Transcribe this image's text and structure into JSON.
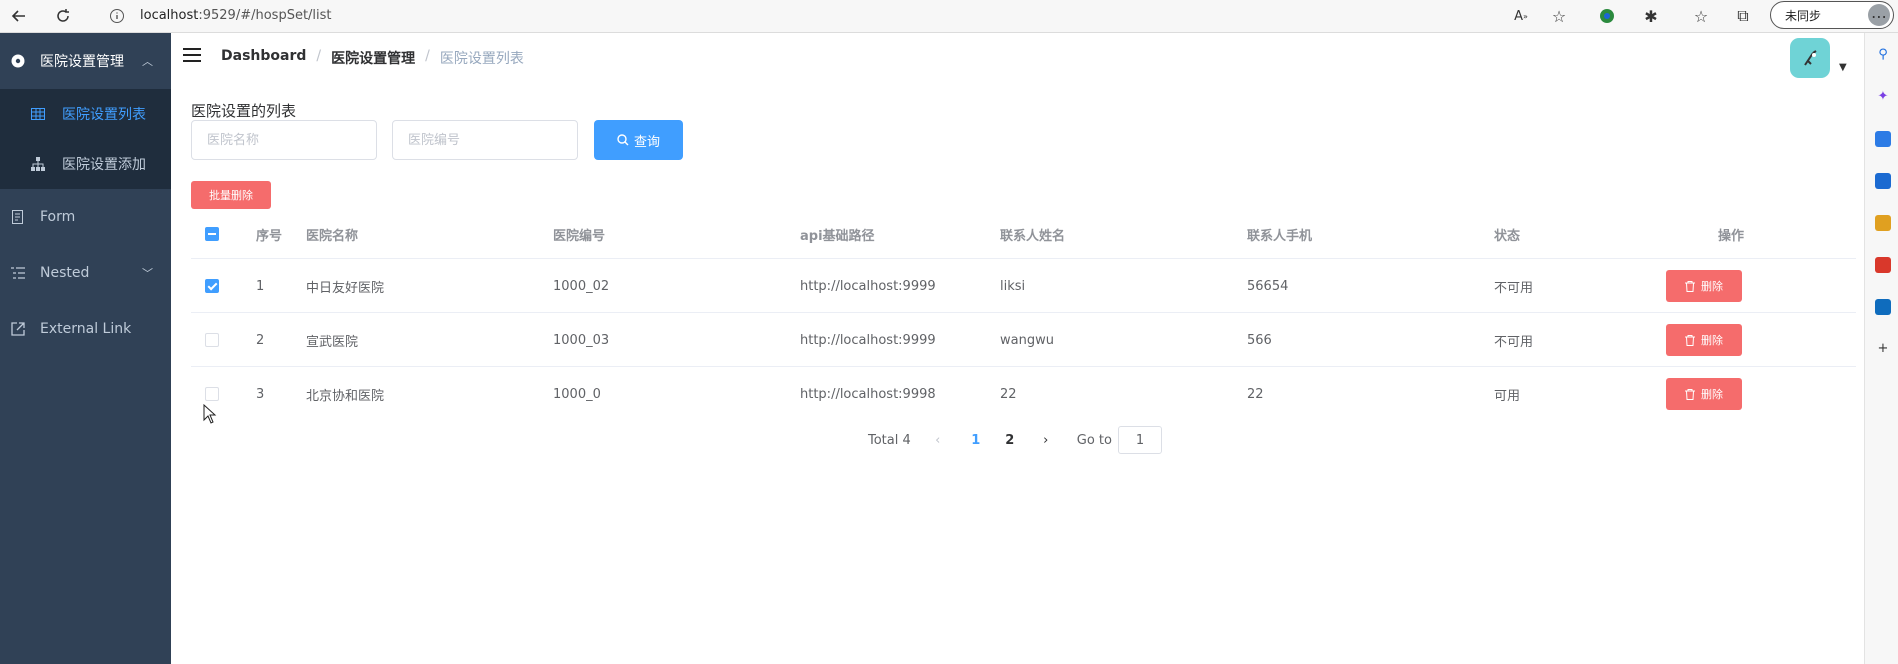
{
  "browser": {
    "url_host": "localhost",
    "url_rest": ":9529/#/hospSet/list",
    "sync_label": "未同步"
  },
  "sidebar": {
    "group_label": "医院设置管理",
    "sub_items": [
      {
        "label": "医院设置列表",
        "active": true,
        "icon": "table-icon"
      },
      {
        "label": "医院设置添加",
        "active": false,
        "icon": "tree-icon"
      }
    ],
    "items": [
      {
        "label": "Form",
        "icon": "form-icon"
      },
      {
        "label": "Nested",
        "icon": "nested-icon"
      },
      {
        "label": "External Link",
        "icon": "link-icon"
      }
    ]
  },
  "breadcrumb": {
    "items": [
      "Dashboard",
      "医院设置管理",
      "医院设置列表"
    ]
  },
  "page": {
    "title": "医院设置的列表",
    "search": {
      "name_placeholder": "医院名称",
      "code_placeholder": "医院编号",
      "query_label": "查询"
    },
    "batch_delete_label": "批量删除"
  },
  "table": {
    "headers": [
      "序号",
      "医院名称",
      "医院编号",
      "api基础路径",
      "联系人姓名",
      "联系人手机",
      "状态",
      "操作"
    ],
    "rows": [
      {
        "checked": true,
        "index": "1",
        "name": "中日友好医院",
        "code": "1000_02",
        "api": "http://localhost:9999",
        "contact": "liksi",
        "phone": "56654",
        "status": "不可用",
        "action": "删除"
      },
      {
        "checked": false,
        "index": "2",
        "name": "宣武医院",
        "code": "1000_03",
        "api": "http://localhost:9999",
        "contact": "wangwu",
        "phone": "566",
        "status": "不可用",
        "action": "删除"
      },
      {
        "checked": false,
        "index": "3",
        "name": "北京协和医院",
        "code": "1000_0",
        "api": "http://localhost:9998",
        "contact": "22",
        "phone": "22",
        "status": "可用",
        "action": "删除"
      }
    ]
  },
  "pagination": {
    "total_label": "Total 4",
    "pages": [
      "1",
      "2"
    ],
    "current": "1",
    "goto_label": "Go to",
    "goto_value": "1"
  },
  "colors": {
    "sidebar": "#304156",
    "primary": "#409eff",
    "danger": "#f56c6c"
  }
}
